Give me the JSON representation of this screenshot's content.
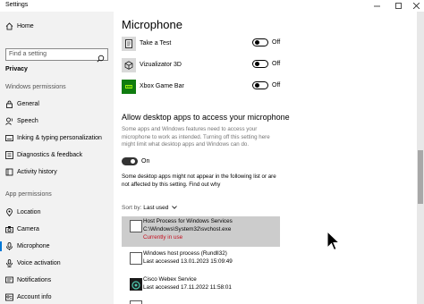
{
  "window": {
    "title": "Settings",
    "minimize_icon": "minimize-icon",
    "maximize_icon": "maximize-icon",
    "close_icon": "close-icon"
  },
  "sidebar": {
    "home_label": "Home",
    "search_placeholder": "Find a setting",
    "privacy_label": "Privacy",
    "windows_permissions_header": "Windows permissions",
    "windows_items": [
      {
        "label": "General",
        "icon": "lock-icon"
      },
      {
        "label": "Speech",
        "icon": "speech-icon"
      },
      {
        "label": "Inking & typing personalization",
        "icon": "inking-icon"
      },
      {
        "label": "Diagnostics & feedback",
        "icon": "diagnostics-icon"
      },
      {
        "label": "Activity history",
        "icon": "history-icon"
      }
    ],
    "app_permissions_header": "App permissions",
    "app_items": [
      {
        "label": "Location",
        "icon": "location-icon"
      },
      {
        "label": "Camera",
        "icon": "camera-icon"
      },
      {
        "label": "Microphone",
        "icon": "microphone-icon",
        "active": true
      },
      {
        "label": "Voice activation",
        "icon": "voice-activation-icon"
      },
      {
        "label": "Notifications",
        "icon": "notifications-icon"
      },
      {
        "label": "Account info",
        "icon": "account-info-icon"
      }
    ]
  },
  "main": {
    "title": "Microphone",
    "apps": [
      {
        "name": "Take a Test",
        "toggle_state": "Off"
      },
      {
        "name": "Vizualizator 3D",
        "toggle_state": "Off"
      },
      {
        "name": "Xbox Game Bar",
        "toggle_state": "Off"
      }
    ],
    "desktop_section": {
      "heading": "Allow desktop apps to access your microphone",
      "description": "Some apps and Windows features need to access your microphone to work as intended. Turning off this setting here might limit what desktop apps and Windows can do.",
      "toggle_state": "On",
      "note": "Some desktop apps might not appear in the following list or are not affected by this setting.",
      "note_link": "Find out why"
    },
    "sort": {
      "label": "Sort by:",
      "value": "Last used"
    },
    "processes": [
      {
        "name": "Host Process for Windows Services",
        "detail": "C:\\Windows\\System32\\svchost.exe",
        "status": "Currently in use",
        "selected": true
      },
      {
        "name": "Windows host process (Rundll32)",
        "detail": "Last accessed 13.01.2023 15:09:49"
      },
      {
        "name": "Cisco Webex Service",
        "detail": "Last accessed 17.11.2022 11:58:01"
      }
    ]
  },
  "colors": {
    "accent": "#0078d7",
    "in_use": "#c50f1f",
    "selected_row": "#cccccc",
    "sidebar_bg": "#f2f2f2"
  }
}
